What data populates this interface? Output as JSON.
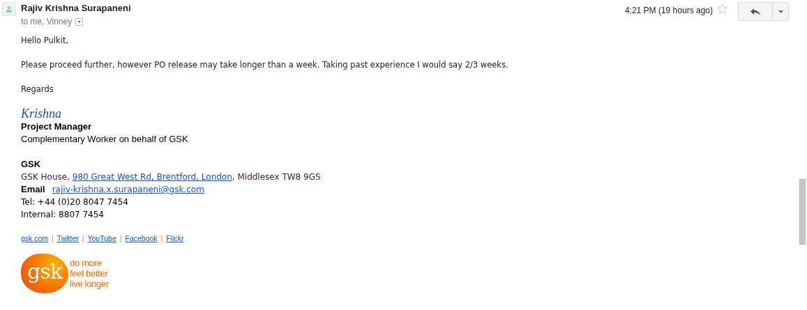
{
  "header": {
    "sender": "Rajiv Krishna Surapaneni",
    "recipients": "to me, Vinney",
    "time": "4:21 PM (19 hours ago)",
    "starred": false
  },
  "body": {
    "greeting": "Hello Pulkit,",
    "message": "Please proceed further, however PO release may take longer than a week. Taking past experience I would say 2/3 weeks.",
    "closing": "Regards"
  },
  "signature": {
    "name": "Krishna",
    "title": "Project Manager",
    "role": "Complementary Worker on behalf of GSK",
    "company": "GSK",
    "address_prefix": "GSK House, ",
    "address_link": "980 Great West Rd, Brentford, London",
    "address_suffix": ", Middlesex TW8 9GS",
    "email_label": "Email",
    "email": "rajiv-krishna.x.surapaneni@gsk.com",
    "tel": "Tel: +44 (0)20 8047 7454",
    "internal": "Internal: 8807 7454",
    "links": [
      "gsk.com",
      "Twitter",
      "YouTube",
      "Facebook",
      "Flickr"
    ],
    "separator": "|",
    "logo": {
      "mark": "gsk",
      "tagline": [
        "do more",
        "feel better",
        "live longer"
      ]
    }
  }
}
